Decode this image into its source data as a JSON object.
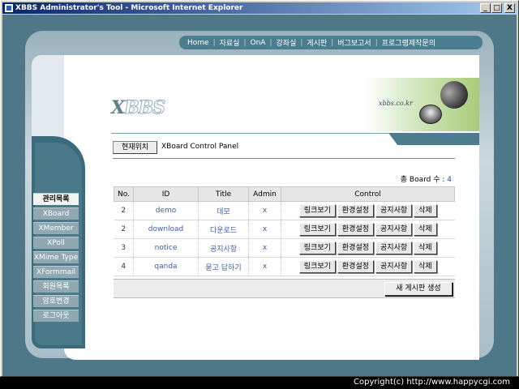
{
  "window": {
    "title": "XBBS Administrator's Tool - Microsoft Internet Explorer",
    "min": "_",
    "max": "□",
    "close": "X"
  },
  "topnav": [
    "Home",
    "자료실",
    "OnA",
    "강좌실",
    "게시판",
    "버그보고서",
    "프로그램제작문의"
  ],
  "logo": {
    "x": "X",
    "bbs": "BBS"
  },
  "banner": {
    "site": "xbbs.co.kr"
  },
  "location": {
    "button": "현재위치",
    "text": "XBoard Control Panel"
  },
  "board_count": {
    "label": "총 Board 수 : ",
    "value": "4"
  },
  "table": {
    "headers": {
      "no": "No.",
      "id": "ID",
      "title": "Title",
      "admin": "Admin",
      "control": "Control"
    },
    "rows": [
      {
        "no": "2",
        "id": "demo",
        "title": "데모",
        "admin": "x"
      },
      {
        "no": "2",
        "id": "download",
        "title": "다운로드",
        "admin": "x"
      },
      {
        "no": "3",
        "id": "notice",
        "title": "공지사항",
        "admin": "x"
      },
      {
        "no": "4",
        "id": "qanda",
        "title": "묻고 답하기",
        "admin": "x"
      }
    ],
    "controls": {
      "link": "링크보기",
      "settings": "환경설정",
      "notice": "공지사항",
      "delete": "삭제"
    },
    "new_board": "새 게시판 생성"
  },
  "sidebar": {
    "items": [
      "관리목록",
      "XBoard",
      "XMember",
      "XPoll",
      "XMime Type",
      "XFormmail",
      "회원목록",
      "암호변경",
      "로그아웃"
    ]
  },
  "copyright": "Copyright(c) http://www.happycgi.com"
}
